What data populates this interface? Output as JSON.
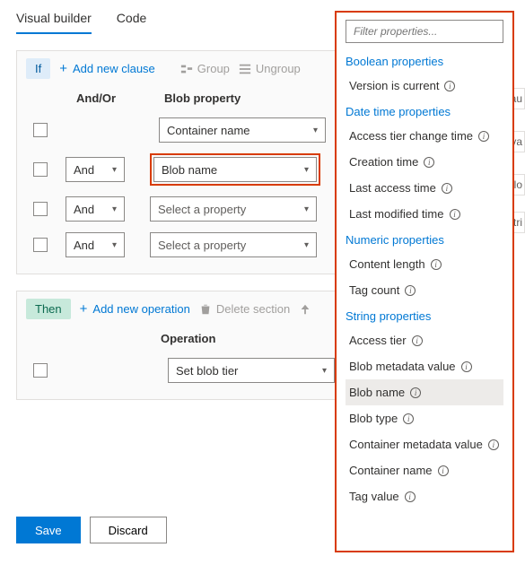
{
  "tabs": {
    "visual": "Visual builder",
    "code": "Code"
  },
  "if": {
    "label": "If",
    "add": "Add new clause",
    "group": "Group",
    "ungroup": "Ungroup",
    "headers": {
      "andor": "And/Or",
      "prop": "Blob property"
    },
    "rows": [
      {
        "andor": "",
        "prop": "Container name",
        "placeholder": false
      },
      {
        "andor": "And",
        "prop": "Blob name",
        "placeholder": false,
        "highlight": true
      },
      {
        "andor": "And",
        "prop": "Select a property",
        "placeholder": true
      },
      {
        "andor": "And",
        "prop": "Select a property",
        "placeholder": true
      }
    ]
  },
  "then": {
    "label": "Then",
    "add": "Add new operation",
    "delete": "Delete section",
    "header": "Operation",
    "row": {
      "op": "Set blob tier"
    }
  },
  "footer": {
    "save": "Save",
    "discard": "Discard"
  },
  "panel": {
    "filter_placeholder": "Filter properties...",
    "groups": [
      {
        "title": "Boolean properties",
        "items": [
          {
            "label": "Version is current"
          }
        ]
      },
      {
        "title": "Date time properties",
        "items": [
          {
            "label": "Access tier change time"
          },
          {
            "label": "Creation time"
          },
          {
            "label": "Last access time"
          },
          {
            "label": "Last modified time"
          }
        ]
      },
      {
        "title": "Numeric properties",
        "items": [
          {
            "label": "Content length"
          },
          {
            "label": "Tag count"
          }
        ]
      },
      {
        "title": "String properties",
        "items": [
          {
            "label": "Access tier"
          },
          {
            "label": "Blob metadata value"
          },
          {
            "label": "Blob name",
            "selected": true
          },
          {
            "label": "Blob type"
          },
          {
            "label": "Container metadata value"
          },
          {
            "label": "Container name"
          },
          {
            "label": "Tag value"
          }
        ]
      }
    ]
  },
  "edge": {
    "a": "au",
    "b": "va",
    "c": "-lo",
    "d": "stri"
  }
}
